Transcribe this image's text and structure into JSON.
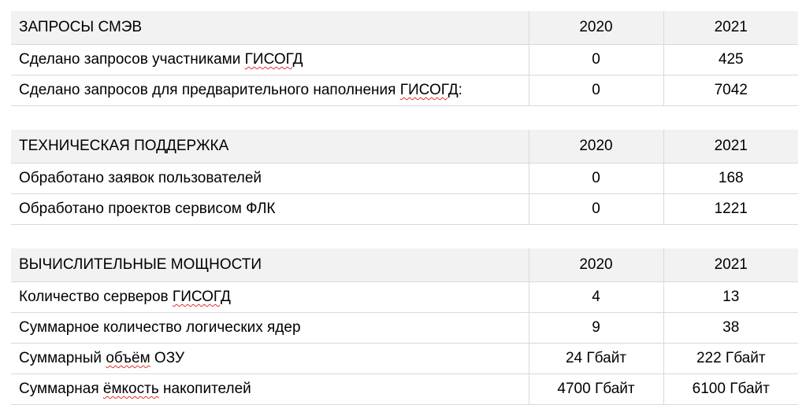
{
  "sections": [
    {
      "title": "ЗАПРОСЫ СМЭВ",
      "year1": "2020",
      "year2": "2021",
      "rows": [
        {
          "pre": "Сделано запросов участниками ",
          "mark": "ГИСОГД",
          "post": "",
          "v1": "0",
          "v2": "425"
        },
        {
          "pre": "Сделано запросов для предварительного наполнения ",
          "mark": "ГИСОГД",
          "post": ":",
          "v1": "0",
          "v2": "7042"
        }
      ]
    },
    {
      "title": "ТЕХНИЧЕСКАЯ ПОДДЕРЖКА",
      "year1": "2020",
      "year2": "2021",
      "rows": [
        {
          "pre": "Обработано заявок пользователей",
          "mark": "",
          "post": "",
          "v1": "0",
          "v2": "168"
        },
        {
          "pre": "Обработано проектов сервисом ФЛК",
          "mark": "",
          "post": "",
          "v1": "0",
          "v2": "1221"
        }
      ]
    },
    {
      "title": "ВЫЧИСЛИТЕЛЬНЫЕ МОЩНОСТИ",
      "year1": "2020",
      "year2": "2021",
      "rows": [
        {
          "pre": "Количество серверов ",
          "mark": "ГИСОГД",
          "post": "",
          "v1": "4",
          "v2": "13"
        },
        {
          "pre": "Суммарное количество логических ядер",
          "mark": "",
          "post": "",
          "v1": "9",
          "v2": "38"
        },
        {
          "pre": "Суммарный ",
          "mark": "объём",
          "post": " ОЗУ",
          "v1": "24 Гбайт",
          "v2": "222 Гбайт"
        },
        {
          "pre": "Суммарная ",
          "mark": "ёмкость",
          "post": " накопителей",
          "v1": "4700 Гбайт",
          "v2": "6100 Гбайт"
        }
      ]
    }
  ]
}
